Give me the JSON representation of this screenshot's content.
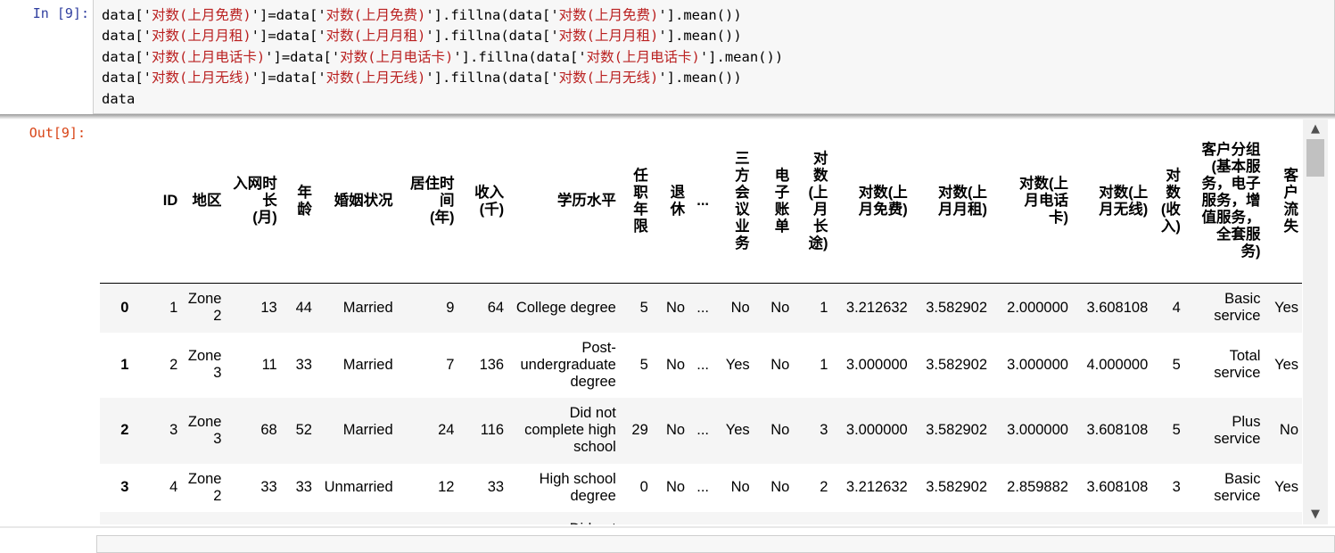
{
  "input_cell": {
    "prompt": "In  [9]:",
    "lines": [
      [
        "data['",
        "对数(上月免费)",
        "']=data['",
        "对数(上月免费)",
        "'].fillna(data['",
        "对数(上月免费)",
        "'].mean())"
      ],
      [
        "data['",
        "对数(上月月租)",
        "']=data['",
        "对数(上月月租)",
        "'].fillna(data['",
        "对数(上月月租)",
        "'].mean())"
      ],
      [
        "data['",
        "对数(上月电话卡)",
        "']=data['",
        "对数(上月电话卡)",
        "'].fillna(data['",
        "对数(上月电话卡)",
        "'].mean())"
      ],
      [
        "data['",
        "对数(上月无线)",
        "']=data['",
        "对数(上月无线)",
        "'].fillna(data['",
        "对数(上月无线)",
        "'].mean())"
      ],
      [
        "data"
      ]
    ]
  },
  "output_cell": {
    "prompt": "Out[9]:",
    "columns": [
      "",
      "ID",
      "地区",
      "入网时长(月)",
      "年龄",
      "婚姻状况",
      "居住时间(年)",
      "收入(千)",
      "学历水平",
      "任职年限",
      "退休",
      "...",
      "三方会议业务",
      "电子账单",
      "对数(上月长途)",
      "对数(上月免费)",
      "对数(上月月租)",
      "对数(上月电话卡)",
      "对数(上月无线)",
      "对数(收入)",
      "客户分组(基本服务，电子服务，增值服务，全套服务)",
      "客户流失"
    ],
    "column_html": [
      "",
      "ID",
      "地区",
      "入网时<br>长<br>(月)",
      "年<br>龄",
      "婚姻状况",
      "居住时<br>间<br>(年)",
      "收入<br>(千)",
      "学历水平",
      "任<br>职<br>年<br>限",
      "退<br>休",
      "...",
      "三<br>方<br>会<br>议<br>业<br>务",
      "电<br>子<br>账<br>单",
      "对<br>数<br>(上<br>月<br>长<br>途)",
      "对数(上<br>月免费)",
      "对数(上<br>月月租)",
      "对数(上<br>月电话<br>卡)",
      "对数(上<br>月无线)",
      "对<br>数<br>(收<br>入)",
      "客户分组<br>(基本服<br>务，电子<br>服务，增<br>值服务，<br>全套服<br>务)",
      "客<br>户<br>流<br>失"
    ],
    "rows": [
      [
        "0",
        "1",
        "Zone 2",
        "13",
        "44",
        "Married",
        "9",
        "64",
        "College degree",
        "5",
        "No",
        "...",
        "No",
        "No",
        "1",
        "3.212632",
        "3.582902",
        "2.000000",
        "3.608108",
        "4",
        "Basic service",
        "Yes"
      ],
      [
        "1",
        "2",
        "Zone 3",
        "11",
        "33",
        "Married",
        "7",
        "136",
        "Post-undergraduate degree",
        "5",
        "No",
        "...",
        "Yes",
        "No",
        "1",
        "3.000000",
        "3.582902",
        "3.000000",
        "4.000000",
        "5",
        "Total service",
        "Yes"
      ],
      [
        "2",
        "3",
        "Zone 3",
        "68",
        "52",
        "Married",
        "24",
        "116",
        "Did not complete high school",
        "29",
        "No",
        "...",
        "Yes",
        "No",
        "3",
        "3.000000",
        "3.582902",
        "3.000000",
        "3.608108",
        "5",
        "Plus service",
        "No"
      ],
      [
        "3",
        "4",
        "Zone 2",
        "33",
        "33",
        "Unmarried",
        "12",
        "33",
        "High school degree",
        "0",
        "No",
        "...",
        "No",
        "No",
        "2",
        "3.212632",
        "3.582902",
        "2.859882",
        "3.608108",
        "3",
        "Basic service",
        "Yes"
      ],
      [
        "",
        "",
        "",
        "",
        "",
        "",
        "",
        "",
        "Did not",
        "",
        "",
        "",
        "",
        "",
        "",
        "",
        "",
        "",
        "",
        "",
        "",
        ""
      ]
    ]
  },
  "scrollbar": {
    "up_icon": "▲",
    "down_icon": "▼"
  }
}
